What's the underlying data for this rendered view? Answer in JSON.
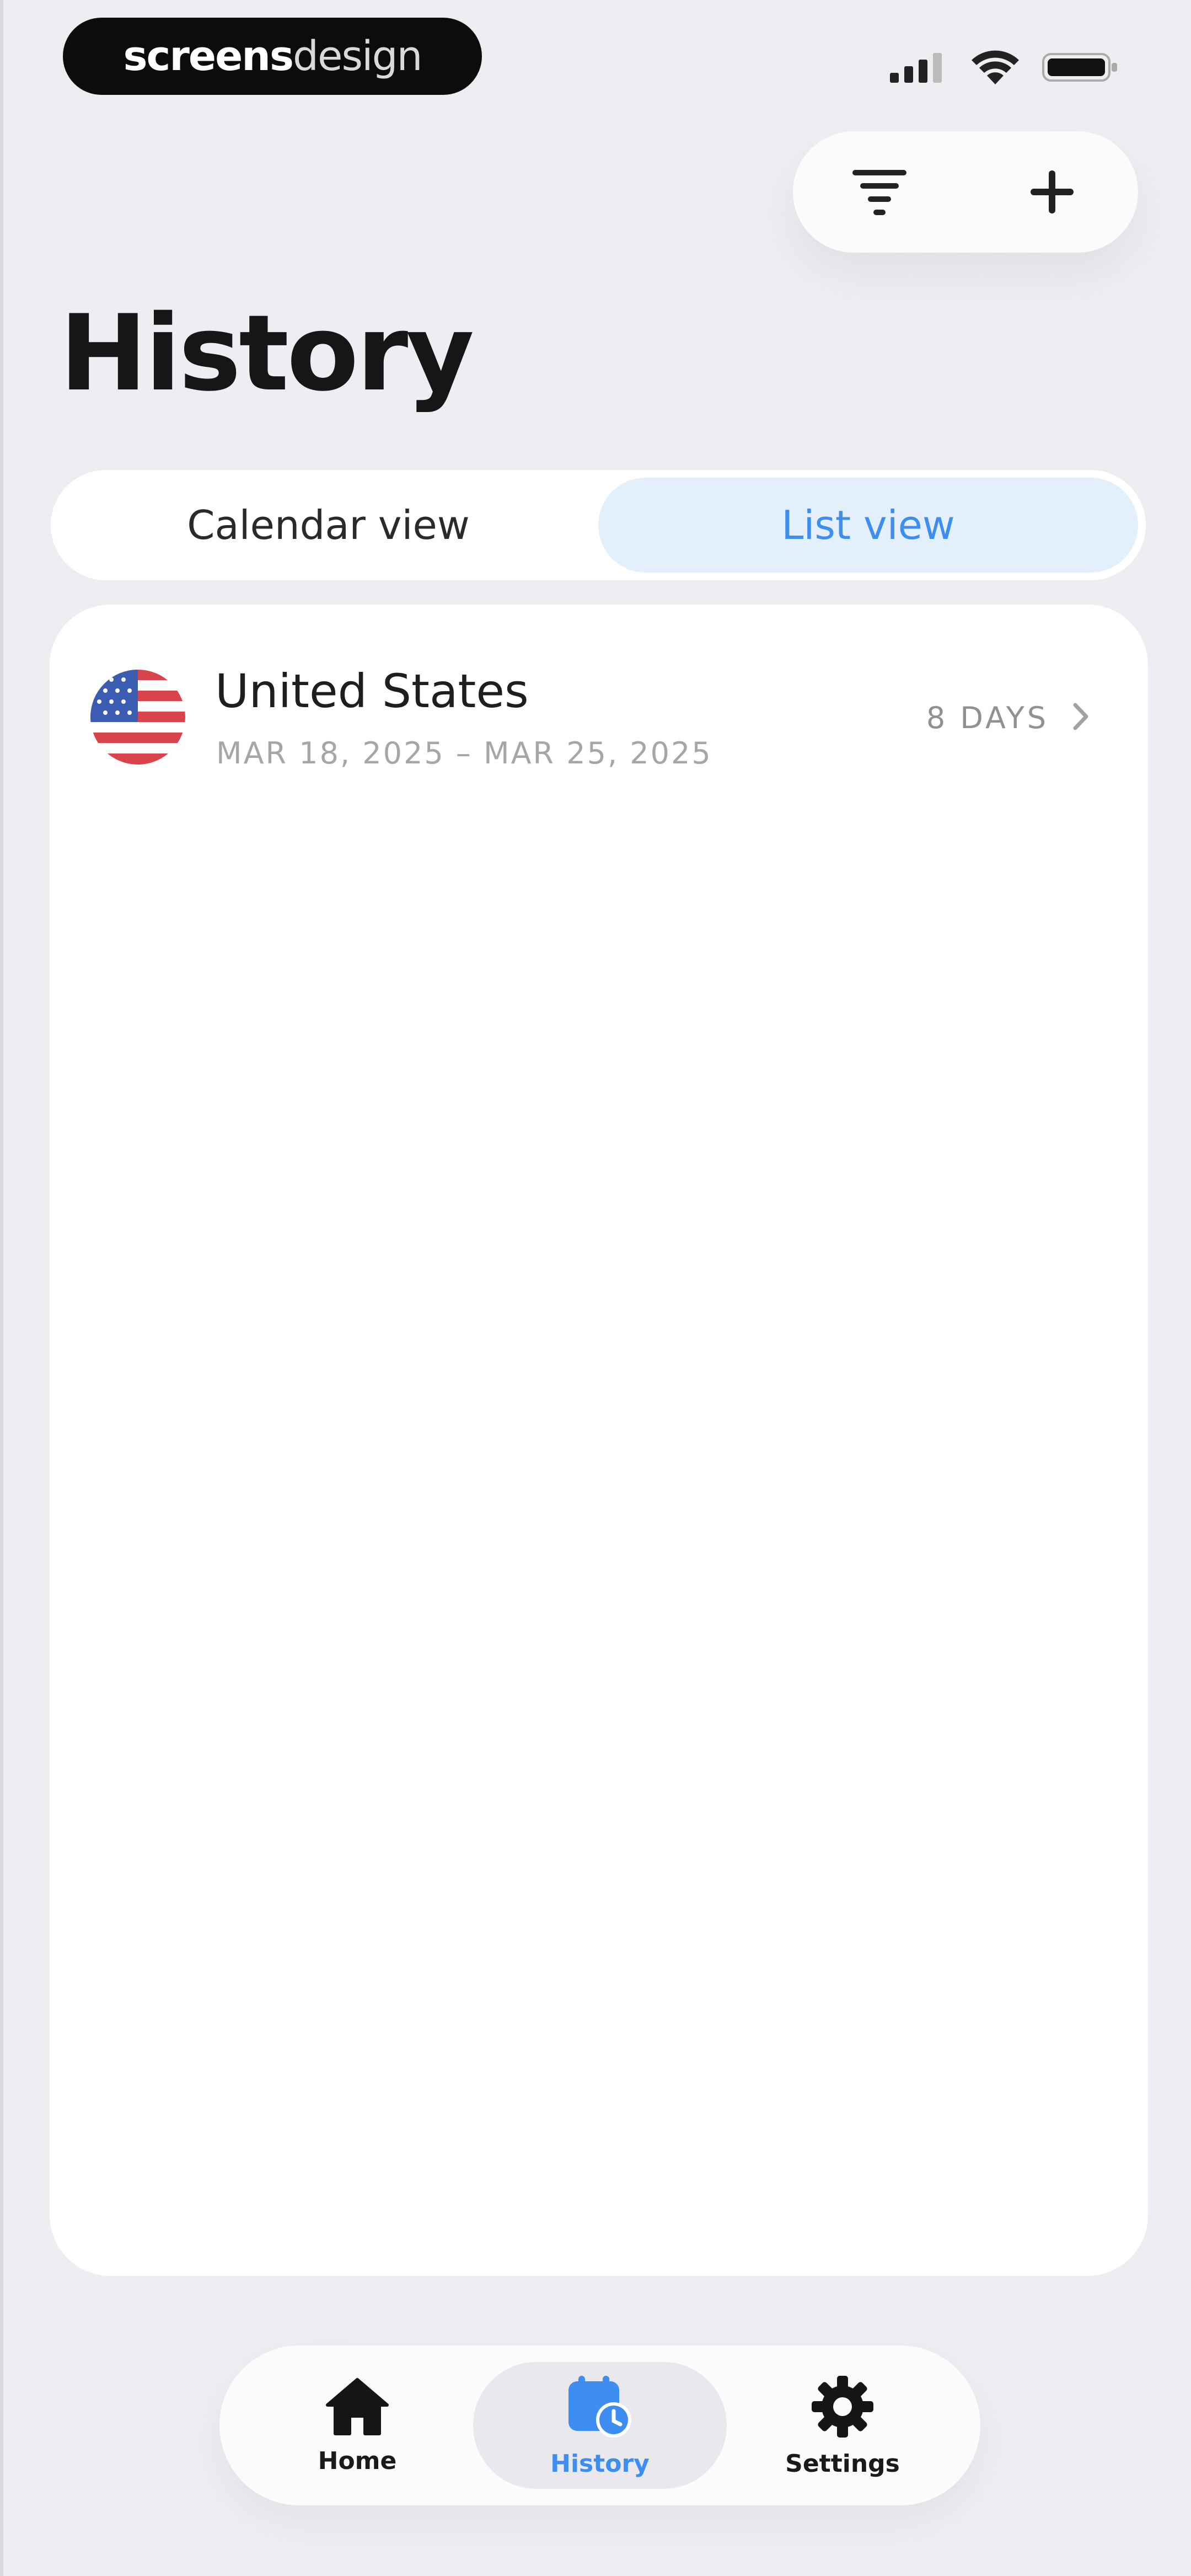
{
  "brand": {
    "part1": "screens",
    "part2": "design"
  },
  "status_bar": {
    "signal": "signal-icon",
    "wifi": "wifi-icon",
    "battery": "battery-icon"
  },
  "actions": {
    "filter_icon": "filter-icon",
    "add_icon": "plus-icon"
  },
  "page": {
    "title": "History"
  },
  "view_toggle": {
    "options": [
      {
        "label": "Calendar view",
        "active": false
      },
      {
        "label": "List view",
        "active": true
      }
    ]
  },
  "trips": [
    {
      "country": "United States",
      "flag": "us-flag-icon",
      "dates": "MAR 18, 2025 – MAR 25, 2025",
      "duration": "8 DAYS"
    }
  ],
  "tab_bar": {
    "items": [
      {
        "label": "Home",
        "icon": "home-icon",
        "active": false
      },
      {
        "label": "History",
        "icon": "history-icon",
        "active": true
      },
      {
        "label": "Settings",
        "icon": "gear-icon",
        "active": false
      }
    ]
  },
  "colors": {
    "accent": "#3d8ef0",
    "background": "#eeeef2",
    "card": "#ffffff",
    "segment_active": "#e3effb"
  }
}
